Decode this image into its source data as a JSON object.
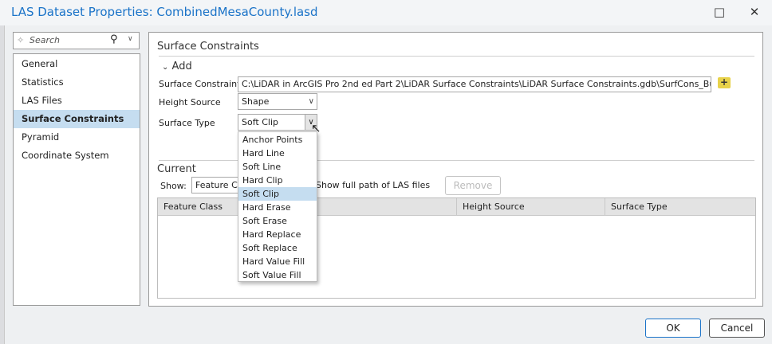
{
  "window": {
    "title": "LAS Dataset Properties: CombinedMesaCounty.lasd",
    "maximize_icon": "□",
    "close_icon": "✕"
  },
  "sidebar": {
    "search_placeholder": "Search",
    "items": [
      {
        "label": "General"
      },
      {
        "label": "Statistics"
      },
      {
        "label": "LAS Files"
      },
      {
        "label": "Surface Constraints",
        "selected": true
      },
      {
        "label": "Pyramid"
      },
      {
        "label": "Coordinate System"
      }
    ]
  },
  "main": {
    "section_title": "Surface Constraints",
    "add": {
      "label": "Add",
      "surface_constraint_label": "Surface Constraint",
      "surface_constraint_value": "C:\\LiDAR in ArcGIS Pro 2nd ed Part 2\\LiDAR Surface Constraints\\LiDAR Surface Constraints.gdb\\SurfCons_Buildings",
      "height_source_label": "Height Source",
      "height_source_value": "Shape",
      "surface_type_label": "Surface Type",
      "surface_type_value": "Soft Clip",
      "surface_type_options": [
        "Anchor Points",
        "Hard Line",
        "Soft Line",
        "Hard Clip",
        "Soft Clip",
        "Hard Erase",
        "Soft Erase",
        "Hard Replace",
        "Soft Replace",
        "Hard Value Fill",
        "Soft Value Fill"
      ],
      "selected_option": "Soft Clip"
    },
    "current": {
      "label": "Current",
      "show_label": "Show:",
      "show_value": "Feature Class",
      "full_path_label": "Show full path of LAS files",
      "remove_label": "Remove",
      "columns": [
        "Feature Class",
        "Height Source",
        "Surface Type"
      ]
    }
  },
  "footer": {
    "ok_label": "OK",
    "cancel_label": "Cancel"
  },
  "colors": {
    "accent": "#1a73c8",
    "selection": "#c5ddf0"
  }
}
